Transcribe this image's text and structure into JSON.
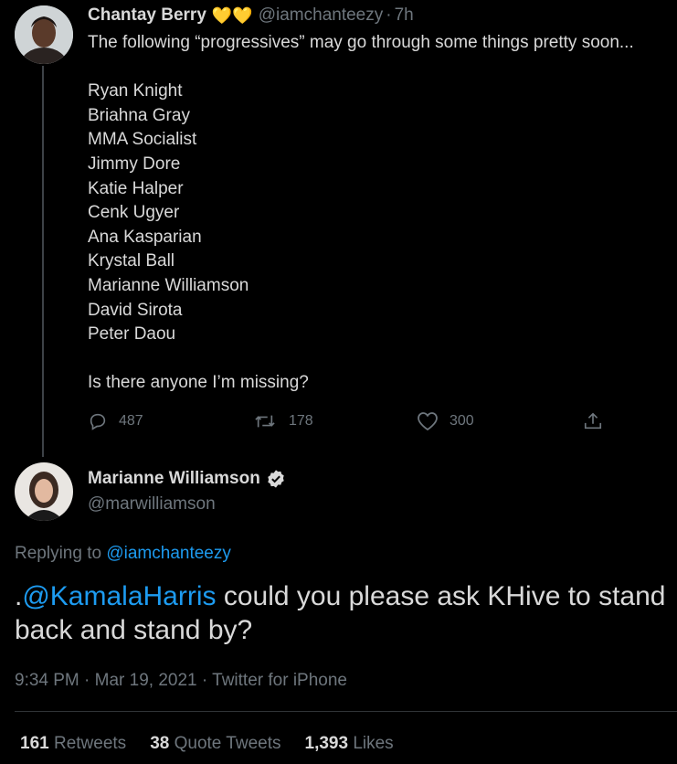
{
  "parent_tweet": {
    "author_name": "Chantay Berry",
    "author_emoji": "💛💛",
    "author_handle": "@iamchanteezy",
    "separator": "·",
    "time_ago": "7h",
    "intro": "The following “progressives” may go through some things pretty soon...",
    "names": [
      "Ryan Knight",
      "Briahna Gray",
      "MMA Socialist",
      "Jimmy Dore",
      "Katie Halper",
      "Cenk Ugyer",
      "Ana Kasparian",
      "Krystal Ball",
      "Marianne Williamson",
      "David Sirota",
      "Peter Daou"
    ],
    "closing": "Is there anyone I’m missing?",
    "replies": "487",
    "retweets": "178",
    "likes": "300"
  },
  "main_tweet": {
    "author_name": "Marianne Williamson",
    "author_handle": "@marwilliamson",
    "replying_prefix": "Replying to ",
    "replying_to": "@iamchanteezy",
    "text_prefix": ".",
    "mention": "@KamalaHarris",
    "text_rest": " could you please ask KHive to stand back and stand by?",
    "meta": "9:34 PM · Mar 19, 2021 · Twitter for iPhone",
    "stats": {
      "retweets_count": "161",
      "retweets_label": "Retweets",
      "quotes_count": "38",
      "quotes_label": "Quote Tweets",
      "likes_count": "1,393",
      "likes_label": "Likes"
    }
  },
  "colors": {
    "background": "#000000",
    "text": "#d9d9d9",
    "muted": "#6e767d",
    "accent": "#1d9bf0",
    "verified": "#d9d9d9"
  },
  "icons": [
    "reply-icon",
    "retweet-icon",
    "like-icon",
    "share-icon",
    "verified-badge-icon"
  ]
}
